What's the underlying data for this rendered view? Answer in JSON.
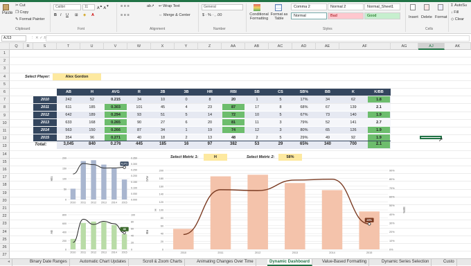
{
  "ribbon": {
    "clipboard": {
      "cut": "Cut",
      "copy": "Copy",
      "paste": "Paste",
      "format_painter": "Format Painter",
      "group": "Clipboard"
    },
    "font": {
      "name": "Calibri",
      "size": "11",
      "group": "Font"
    },
    "alignment": {
      "wrap": "Wrap Text",
      "merge": "Merge & Center",
      "group": "Alignment"
    },
    "number": {
      "format": "General",
      "group": "Number"
    },
    "styles": {
      "conditional": "Conditional Formatting",
      "format_table": "Format as Table",
      "cells": [
        "Comma 2",
        "Normal 2",
        "Normal_Sheet1",
        "Normal",
        "Bad",
        "Good"
      ],
      "group": "Styles"
    },
    "cells_group": {
      "insert": "Insert",
      "delete": "Delete",
      "format": "Format",
      "group": "Cells"
    },
    "editing": {
      "autosum": "AutoSu",
      "fill": "Fill",
      "clear": "Clear"
    }
  },
  "formula_bar": {
    "name_box": "AJ13"
  },
  "columns": [
    "Q",
    "R",
    "S",
    "T",
    "U",
    "V",
    "W",
    "X",
    "Y",
    "Z",
    "AA",
    "AB",
    "AC",
    "AD",
    "AE",
    "AF",
    "AG",
    "AJ",
    "AK"
  ],
  "rows": [
    "1",
    "2",
    "3",
    "4",
    "5",
    "6",
    "7",
    "8",
    "9",
    "10",
    "11",
    "12",
    "13",
    "14",
    "15",
    "16",
    "17",
    "18",
    "19",
    "20",
    "21",
    "22",
    "23",
    "24",
    "25",
    "26",
    "27"
  ],
  "player": {
    "label": "Select Player:",
    "value": "Alex Gordon"
  },
  "stats": {
    "headers": [
      "AB",
      "H",
      "AVG",
      "R",
      "2B",
      "3B",
      "HR",
      "RBI",
      "SB",
      "CS",
      "SB%",
      "BB",
      "K",
      "K/BB"
    ],
    "rows": [
      {
        "year": "2010",
        "cells": [
          "242",
          "52",
          "0.215",
          "34",
          "10",
          "0",
          "8",
          "20",
          "1",
          "5",
          "17%",
          "34",
          "62",
          "1.8"
        ]
      },
      {
        "year": "2011",
        "cells": [
          "611",
          "185",
          "0.303",
          "101",
          "45",
          "4",
          "23",
          "87",
          "17",
          "8",
          "68%",
          "67",
          "139",
          "2.1"
        ]
      },
      {
        "year": "2012",
        "cells": [
          "642",
          "189",
          "0.294",
          "93",
          "51",
          "5",
          "14",
          "72",
          "10",
          "5",
          "67%",
          "73",
          "140",
          "1.9"
        ]
      },
      {
        "year": "2013",
        "cells": [
          "633",
          "168",
          "0.265",
          "90",
          "27",
          "6",
          "20",
          "81",
          "11",
          "3",
          "79%",
          "52",
          "141",
          "2.7"
        ]
      },
      {
        "year": "2014",
        "cells": [
          "563",
          "150",
          "0.266",
          "87",
          "34",
          "1",
          "19",
          "74",
          "12",
          "3",
          "80%",
          "65",
          "126",
          "1.9"
        ]
      },
      {
        "year": "2015",
        "cells": [
          "354",
          "96",
          "0.271",
          "40",
          "18",
          "2",
          "13",
          "48",
          "2",
          "5",
          "29%",
          "49",
          "92",
          "1.9"
        ]
      }
    ],
    "total_label": "Total:",
    "totals": [
      "3,045",
      "840",
      "0.276",
      "445",
      "185",
      "16",
      "97",
      "382",
      "53",
      "29",
      "65%",
      "340",
      "700",
      "2.1"
    ]
  },
  "metrics": {
    "label1": "Select Metric 1:",
    "value1": "H",
    "label2": "Select Metric 2:",
    "value2": "58%"
  },
  "colors": {
    "header_navy": "#34465e",
    "green": "#6dbd6d",
    "highlight": "#fde9a0",
    "bar_blue": "#a9b6cf",
    "bar_green": "#b9dca7",
    "bar_salmon": "#f4c3ab",
    "line_brown": "#7b3b22"
  },
  "chart_data": [
    {
      "type": "bar",
      "categories": [
        "2010",
        "2011",
        "2012",
        "2013",
        "2014",
        "2015"
      ],
      "series": [
        {
          "name": "Hits",
          "values": [
            52,
            185,
            189,
            168,
            150,
            96
          ]
        },
        {
          "name": "AVG",
          "values": [
            0.215,
            0.303,
            0.294,
            0.265,
            0.266,
            0.271
          ]
        }
      ],
      "ylabel": "Hits",
      "y2label": "AVG",
      "y_ticks": [
        "0",
        "50",
        "100",
        "150",
        "200"
      ],
      "y2_ticks": [
        "0.000",
        "0.050",
        "0.100",
        "0.150",
        "0.200",
        "0.250",
        "0.300",
        "0.350"
      ],
      "ylim": [
        0,
        200
      ],
      "y2lim": [
        0,
        0.35
      ],
      "callout": "0.271"
    },
    {
      "type": "bar",
      "categories": [
        "2010",
        "2011",
        "2012",
        "2013",
        "2014",
        "2015"
      ],
      "series": [
        {
          "name": "AB",
          "values": [
            242,
            611,
            642,
            633,
            563,
            354
          ]
        },
        {
          "name": "RBI",
          "values": [
            20,
            87,
            72,
            81,
            74,
            48
          ]
        }
      ],
      "ylabel": "AB",
      "y2label": "RBI",
      "y_ticks": [
        "0",
        "200",
        "400",
        "600",
        "800"
      ],
      "y2_ticks": [
        "0",
        "20",
        "40",
        "60",
        "80",
        "100"
      ],
      "ylim": [
        0,
        800
      ],
      "y2lim": [
        0,
        100
      ],
      "callout": "48"
    },
    {
      "type": "bar",
      "categories": [
        "2010",
        "2011",
        "2012",
        "2013",
        "2014",
        "2015"
      ],
      "series": [
        {
          "name": "H",
          "values": [
            52,
            185,
            189,
            168,
            150,
            96
          ]
        },
        {
          "name": "SB%",
          "values": [
            17,
            68,
            67,
            79,
            80,
            29
          ]
        }
      ],
      "ylabel": "H",
      "y2label": "SB%",
      "y_ticks": [
        "0",
        "20",
        "40",
        "60",
        "80",
        "100",
        "120",
        "140",
        "160",
        "180",
        "200"
      ],
      "y2_ticks": [
        "0%",
        "10%",
        "20%",
        "30%",
        "40%",
        "50%",
        "60%",
        "70%",
        "80%",
        "90%"
      ],
      "ylim": [
        0,
        200
      ],
      "y2lim": [
        0,
        90
      ],
      "callout": "29%"
    }
  ],
  "sheet_tabs": [
    "Binary Date Ranges",
    "Automatic Chart Updates",
    "Scroll & Zoom Charts",
    "Animating Changes Over Time",
    "Dynamic Dashboard",
    "Value-Based Formatting",
    "Dynamic Series Selection",
    "Custo"
  ],
  "active_tab": "Dynamic Dashboard"
}
